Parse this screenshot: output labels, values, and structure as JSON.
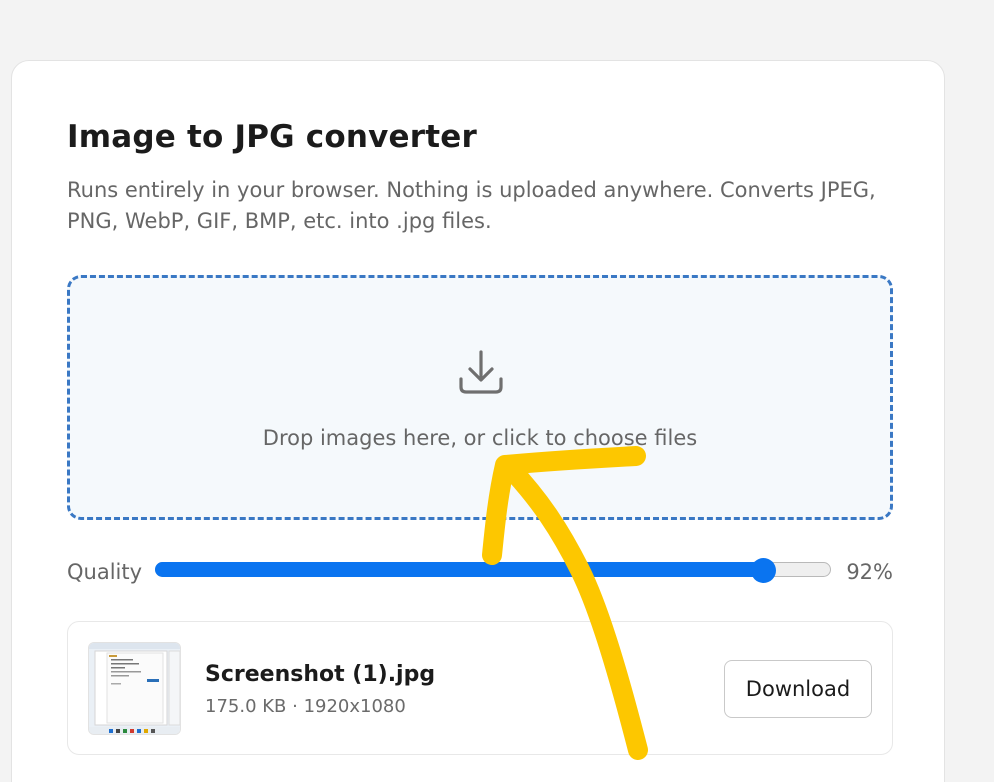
{
  "converter": {
    "title": "Image to JPG converter",
    "description": "Runs entirely in your browser. Nothing is uploaded anywhere. Converts JPEG, PNG, WebP, GIF, BMP, etc. into .jpg files."
  },
  "dropzone": {
    "icon": "download-tray-icon",
    "prompt": "Drop images here, or click to choose files"
  },
  "quality": {
    "label": "Quality",
    "value_text": "92%",
    "slider_level": 0.9
  },
  "files": [
    {
      "name": "Screenshot (1).jpg",
      "meta": "175.0 KB · 1920x1080",
      "download_label": "Download",
      "thumbnail_icon": "screenshot-thumbnail"
    }
  ],
  "annotation": {
    "icon": "hand-drawn-arrow",
    "color": "#fdc700"
  },
  "colors": {
    "accent": "#0a74f0",
    "dropzone_border": "#3a78c4"
  }
}
